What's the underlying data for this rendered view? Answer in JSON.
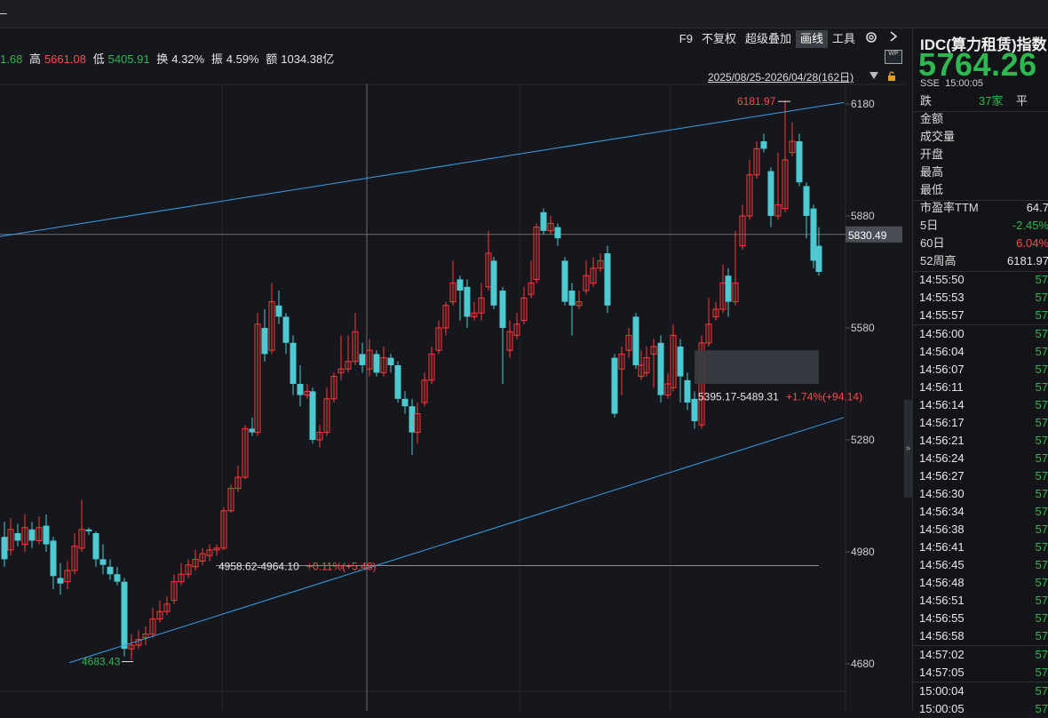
{
  "toolbar": {
    "items": [
      "F9",
      "不复权",
      "超级叠加",
      "画线",
      "工具"
    ],
    "active": "画线"
  },
  "quote": {
    "open_partial": "1.68",
    "high_label": "高",
    "high": "5661.08",
    "low_label": "低",
    "low": "5405.91",
    "turnover_label": "换",
    "turnover": "4.32%",
    "amplitude_label": "振",
    "amplitude": "4.59%",
    "amount_label": "额",
    "amount": "1034.38亿"
  },
  "range_label": "2025/08/25-2026/04/28(162日)",
  "wp_icon_text": "WP",
  "axis": {
    "y_ticks": [
      "6180",
      "5880",
      "5580",
      "5280",
      "4980",
      "4680"
    ],
    "crosshair_price": "5830.49"
  },
  "annotations": {
    "high_marker": "6181.97",
    "low_marker": "4683.43",
    "measure1_range": "4958.62-4964.10",
    "measure1_pct": "+0.11%(+5.48)",
    "measure2_range": "5395.17-5489.31",
    "measure2_pct": "+1.74%(+94.14)"
  },
  "colors": {
    "up": "#ff3b3b",
    "down": "#4ec9d2",
    "trend": "#3aa0e8",
    "price_green": "#2fb84f"
  },
  "chart_data": {
    "type": "candlestick",
    "y_range": [
      4640,
      6260
    ],
    "y_ticks": [
      6180,
      5880,
      5580,
      5280,
      4980,
      4680
    ],
    "crosshair_y": 5830.49,
    "trendline_upper": {
      "from": [
        0,
        5825
      ],
      "to": [
        950,
        6184
      ]
    },
    "trendline_lower": {
      "from": [
        78,
        4683
      ],
      "to": [
        950,
        5340
      ]
    },
    "candles": [
      [
        5,
        5020,
        4960,
        5060,
        4940
      ],
      [
        12,
        4985,
        5040,
        5070,
        4970
      ],
      [
        20,
        5030,
        5010,
        5055,
        4995
      ],
      [
        28,
        5000,
        5045,
        5080,
        4980
      ],
      [
        36,
        5040,
        5010,
        5060,
        4990
      ],
      [
        44,
        5010,
        5045,
        5075,
        5000
      ],
      [
        52,
        5050,
        5000,
        5080,
        4980
      ],
      [
        60,
        5010,
        4915,
        5020,
        4880
      ],
      [
        68,
        4910,
        4895,
        4950,
        4865
      ],
      [
        76,
        4900,
        4930,
        4955,
        4880
      ],
      [
        84,
        4930,
        4995,
        5030,
        4920
      ],
      [
        92,
        4990,
        5040,
        5120,
        4980
      ],
      [
        100,
        5040,
        5035,
        5045,
        5025
      ],
      [
        108,
        5030,
        4960,
        5035,
        4940
      ],
      [
        116,
        4960,
        4945,
        5000,
        4920
      ],
      [
        124,
        4940,
        4920,
        4960,
        4905
      ],
      [
        132,
        4920,
        4900,
        4940,
        4890
      ],
      [
        140,
        4900,
        4720,
        4910,
        4700
      ],
      [
        148,
        4720,
        4730,
        4760,
        4690
      ],
      [
        156,
        4730,
        4745,
        4770,
        4720
      ],
      [
        164,
        4750,
        4760,
        4780,
        4730
      ],
      [
        172,
        4760,
        4800,
        4830,
        4750
      ],
      [
        180,
        4800,
        4820,
        4850,
        4790
      ],
      [
        188,
        4820,
        4840,
        4860,
        4810
      ],
      [
        196,
        4850,
        4900,
        4920,
        4840
      ],
      [
        204,
        4900,
        4920,
        4950,
        4890
      ],
      [
        212,
        4920,
        4945,
        4960,
        4910
      ],
      [
        220,
        4940,
        4960,
        4985,
        4930
      ],
      [
        228,
        4955,
        4975,
        4990,
        4945
      ],
      [
        236,
        4970,
        4985,
        5000,
        4955
      ],
      [
        244,
        4985,
        4990,
        5000,
        4970
      ],
      [
        252,
        4990,
        5090,
        5100,
        4985
      ],
      [
        260,
        5090,
        5150,
        5160,
        5085
      ],
      [
        268,
        5150,
        5180,
        5210,
        5140
      ],
      [
        276,
        5180,
        5310,
        5320,
        5175
      ],
      [
        284,
        5310,
        5300,
        5340,
        5290
      ],
      [
        290,
        5300,
        5590,
        5620,
        5290
      ],
      [
        298,
        5580,
        5510,
        5630,
        5490
      ],
      [
        306,
        5520,
        5650,
        5700,
        5510
      ],
      [
        314,
        5640,
        5610,
        5680,
        5590
      ],
      [
        322,
        5610,
        5540,
        5620,
        5510
      ],
      [
        330,
        5540,
        5430,
        5560,
        5400
      ],
      [
        338,
        5430,
        5400,
        5480,
        5370
      ],
      [
        346,
        5400,
        5410,
        5430,
        5390
      ],
      [
        352,
        5410,
        5280,
        5420,
        5270
      ],
      [
        360,
        5280,
        5300,
        5320,
        5260
      ],
      [
        368,
        5300,
        5390,
        5420,
        5290
      ],
      [
        376,
        5390,
        5450,
        5460,
        5380
      ],
      [
        384,
        5460,
        5470,
        5560,
        5440
      ],
      [
        392,
        5470,
        5490,
        5560,
        5460
      ],
      [
        400,
        5490,
        5570,
        5620,
        5480
      ],
      [
        408,
        5510,
        5480,
        5540,
        5460
      ],
      [
        416,
        5470,
        5520,
        5550,
        5450
      ],
      [
        424,
        5510,
        5460,
        5520,
        5450
      ],
      [
        432,
        5460,
        5500,
        5530,
        5450
      ],
      [
        440,
        5500,
        5480,
        5510,
        5460
      ],
      [
        448,
        5480,
        5390,
        5490,
        5380
      ],
      [
        456,
        5390,
        5370,
        5410,
        5350
      ],
      [
        464,
        5370,
        5300,
        5390,
        5240
      ],
      [
        470,
        5300,
        5350,
        5380,
        5270
      ],
      [
        478,
        5380,
        5440,
        5460,
        5370
      ],
      [
        486,
        5440,
        5510,
        5530,
        5430
      ],
      [
        494,
        5520,
        5580,
        5600,
        5510
      ],
      [
        502,
        5580,
        5640,
        5650,
        5560
      ],
      [
        510,
        5650,
        5700,
        5760,
        5640
      ],
      [
        518,
        5710,
        5680,
        5720,
        5600
      ],
      [
        526,
        5690,
        5610,
        5710,
        5580
      ],
      [
        534,
        5610,
        5620,
        5650,
        5600
      ],
      [
        542,
        5620,
        5660,
        5700,
        5600
      ],
      [
        550,
        5690,
        5780,
        5840,
        5680
      ],
      [
        556,
        5760,
        5640,
        5770,
        5630
      ],
      [
        566,
        5680,
        5580,
        5690,
        5430
      ],
      [
        574,
        5520,
        5570,
        5600,
        5500
      ],
      [
        582,
        5560,
        5590,
        5620,
        5550
      ],
      [
        590,
        5600,
        5660,
        5690,
        5590
      ],
      [
        598,
        5670,
        5700,
        5760,
        5660
      ],
      [
        604,
        5710,
        5850,
        5860,
        5700
      ],
      [
        612,
        5890,
        5840,
        5900,
        5830
      ],
      [
        620,
        5840,
        5860,
        5880,
        5830
      ],
      [
        628,
        5850,
        5820,
        5860,
        5800
      ],
      [
        636,
        5760,
        5650,
        5770,
        5640
      ],
      [
        644,
        5680,
        5640,
        5700,
        5560
      ],
      [
        652,
        5640,
        5650,
        5680,
        5630
      ],
      [
        660,
        5680,
        5720,
        5760,
        5670
      ],
      [
        668,
        5700,
        5740,
        5770,
        5690
      ],
      [
        676,
        5740,
        5760,
        5780,
        5730
      ],
      [
        684,
        5780,
        5640,
        5800,
        5620
      ],
      [
        692,
        5500,
        5350,
        5510,
        5340
      ],
      [
        700,
        5470,
        5510,
        5530,
        5400
      ],
      [
        708,
        5520,
        5560,
        5580,
        5500
      ],
      [
        716,
        5610,
        5480,
        5620,
        5470
      ],
      [
        722,
        5450,
        5480,
        5520,
        5440
      ],
      [
        728,
        5460,
        5500,
        5530,
        5450
      ],
      [
        736,
        5510,
        5530,
        5550,
        5420
      ],
      [
        744,
        5540,
        5400,
        5560,
        5380
      ],
      [
        752,
        5400,
        5430,
        5460,
        5390
      ],
      [
        758,
        5420,
        5560,
        5590,
        5410
      ],
      [
        766,
        5530,
        5450,
        5550,
        5380
      ],
      [
        774,
        5440,
        5380,
        5460,
        5360
      ],
      [
        782,
        5390,
        5330,
        5410,
        5310
      ],
      [
        790,
        5320,
        5540,
        5560,
        5310
      ],
      [
        798,
        5540,
        5590,
        5660,
        5530
      ],
      [
        806,
        5610,
        5630,
        5650,
        5600
      ],
      [
        814,
        5630,
        5700,
        5750,
        5620
      ],
      [
        820,
        5720,
        5650,
        5740,
        5610
      ],
      [
        828,
        5650,
        5700,
        5840,
        5640
      ],
      [
        836,
        5800,
        5880,
        5910,
        5790
      ],
      [
        844,
        5880,
        5990,
        6030,
        5870
      ],
      [
        852,
        5990,
        6060,
        6080,
        5980
      ],
      [
        860,
        6080,
        6060,
        6100,
        6050
      ],
      [
        868,
        6000,
        5880,
        6010,
        5850
      ],
      [
        876,
        5880,
        5910,
        6050,
        5870
      ],
      [
        884,
        5900,
        6030,
        6190,
        5890
      ],
      [
        892,
        6050,
        6080,
        6130,
        6040
      ],
      [
        900,
        6080,
        5970,
        6100,
        5960
      ],
      [
        908,
        5960,
        5880,
        5970,
        5820
      ],
      [
        916,
        5900,
        5760,
        5910,
        5740
      ],
      [
        922,
        5800,
        5730,
        5850,
        5720
      ]
    ]
  },
  "right_panel": {
    "title": "IDC(算力租赁)指数",
    "price": "5764.26",
    "exchange": "SSE",
    "time": "15:00:05",
    "fall_label": "跌",
    "fall_count": "37家",
    "flat_label": "平",
    "fields": [
      {
        "label": "金额",
        "value": ""
      },
      {
        "label": "成交量",
        "value": ""
      },
      {
        "label": "开盘",
        "value": ""
      },
      {
        "label": "最高",
        "value": ""
      },
      {
        "label": "最低",
        "value": ""
      }
    ],
    "stats": [
      {
        "label": "市盈率TTM",
        "value": "64.7",
        "color": "#e6e6e6"
      },
      {
        "label": "5日",
        "value": "-2.45%",
        "color": "#2fb84f"
      },
      {
        "label": "60日",
        "value": "6.04%",
        "color": "#ff4a4a"
      },
      {
        "label": "52周高",
        "value": "6181.97",
        "color": "#e6e6e6"
      }
    ],
    "ticks_label": "57",
    "ticks": [
      "14:55:50",
      "14:55:53",
      "14:55:57",
      "14:56:00",
      "14:56:04",
      "14:56:07",
      "14:56:11",
      "14:56:14",
      "14:56:17",
      "14:56:21",
      "14:56:24",
      "14:56:27",
      "14:56:30",
      "14:56:34",
      "14:56:38",
      "14:56:41",
      "14:56:45",
      "14:56:48",
      "14:56:51",
      "14:56:55",
      "14:56:58",
      "14:57:02",
      "14:57:05",
      "15:00:04",
      "15:00:05"
    ]
  }
}
